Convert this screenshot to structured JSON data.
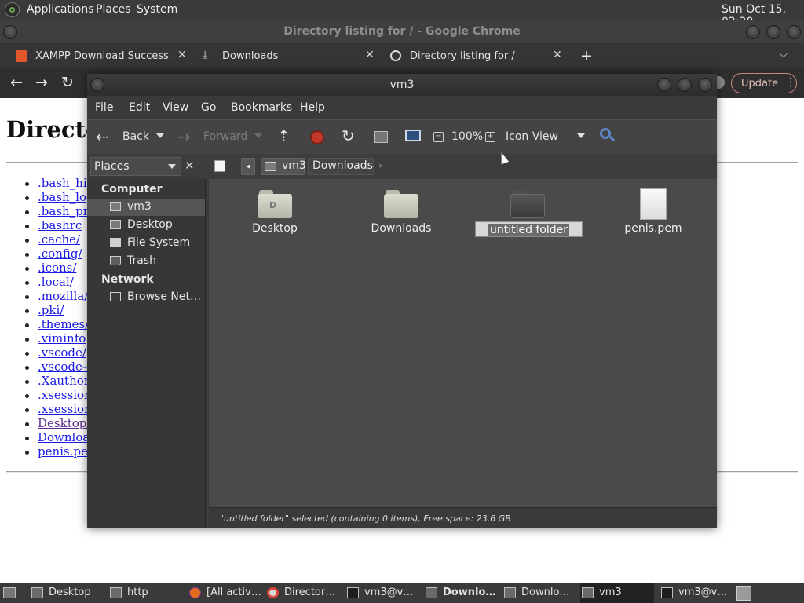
{
  "top_panel": {
    "menus": [
      "Applications",
      "Places",
      "System"
    ],
    "clock": "Sun Oct 15, 02:20"
  },
  "chrome": {
    "window_title": "Directory listing for / - Google Chrome",
    "tabs": [
      {
        "label": "XAMPP Download Success",
        "icon": "xampp-icon"
      },
      {
        "label": "Downloads",
        "icon": "download-icon"
      },
      {
        "label": "Directory listing for /",
        "icon": "globe-icon"
      }
    ],
    "update_label": "Update"
  },
  "page": {
    "heading": "Directory listing for /",
    "entries": [
      ".bash_history",
      ".bash_logout",
      ".bash_profile",
      ".bashrc",
      ".cache/",
      ".config/",
      ".icons/",
      ".local/",
      ".mozilla/",
      ".pki/",
      ".themes/",
      ".viminfo",
      ".vscode/",
      ".vscode-cli/",
      ".Xauthority",
      ".xsession-errors",
      ".xsession-errors.old",
      "Desktop/",
      "Downloads/",
      "penis.pem"
    ]
  },
  "file_manager": {
    "title": "vm3",
    "menus": [
      "File",
      "Edit",
      "View",
      "Go",
      "Bookmarks",
      "Help"
    ],
    "toolbar": {
      "back": "Back",
      "forward": "Forward",
      "zoom": "100%",
      "view_mode": "Icon View"
    },
    "sidebar_selector": "Places",
    "breadcrumbs": [
      "vm3",
      "Downloads"
    ],
    "sidebar": {
      "computer_heading": "Computer",
      "computer_items": [
        "vm3",
        "Desktop",
        "File System",
        "Trash"
      ],
      "network_heading": "Network",
      "network_items": [
        "Browse Net…"
      ]
    },
    "files": [
      {
        "name": "Desktop",
        "type": "folder"
      },
      {
        "name": "Downloads",
        "type": "folder"
      },
      {
        "name": "untitled folder",
        "type": "folder",
        "selected": true
      },
      {
        "name": "penis.pem",
        "type": "file"
      }
    ],
    "status": "\"untitled folder\" selected (containing 0 items), Free space: 23.6 GB"
  },
  "taskbar": {
    "items": [
      {
        "label": "Desktop"
      },
      {
        "label": "http"
      },
      {
        "label": "[All activ…"
      },
      {
        "label": "Director…"
      },
      {
        "label": "vm3@v…"
      },
      {
        "label": "Downlo…",
        "bold": true
      },
      {
        "label": "Downlo…"
      },
      {
        "label": "vm3",
        "active": true
      },
      {
        "label": "vm3@v…"
      }
    ]
  }
}
